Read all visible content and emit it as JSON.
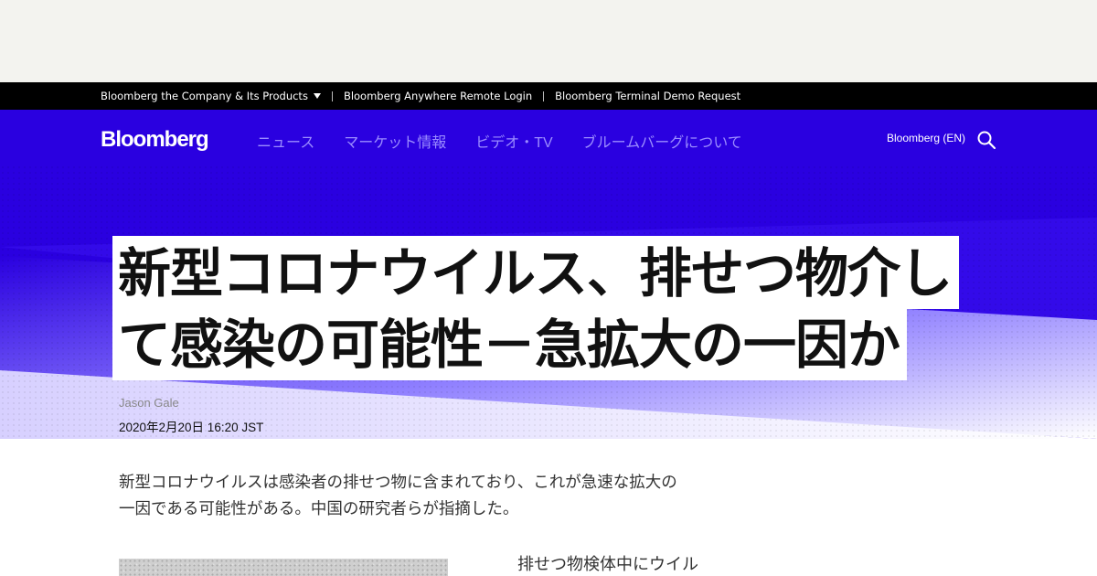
{
  "topbar": {
    "company_products": "Bloomberg the Company & Its Products",
    "anywhere_login": "Bloomberg Anywhere Remote Login",
    "terminal_demo": "Bloomberg Terminal Demo Request"
  },
  "nav": {
    "logo": "Bloomberg",
    "items": [
      {
        "label": "ニュース"
      },
      {
        "label": "マーケット情報"
      },
      {
        "label": "ビデオ・TV"
      },
      {
        "label": "ブルームバーグについて"
      }
    ],
    "edition": "Bloomberg (EN)"
  },
  "article": {
    "headline_line1": "新型コロナウイルス、排せつ物介し",
    "headline_line2": "て感染の可能性－急拡大の一因か",
    "author": "Jason Gale",
    "date": "2020年2月20日 16:20 JST",
    "abstract_line1": "新型コロナウイルスは感染者の排せつ物に含まれており、これが急速な拡大の",
    "abstract_line2": "一因である可能性がある。中国の研究者らが指摘した。",
    "bullet": "排せつ物検体中にウイル"
  },
  "colors": {
    "hero": "#2a00e0",
    "nav_link": "#9b8cff",
    "topbar": "#000000"
  }
}
